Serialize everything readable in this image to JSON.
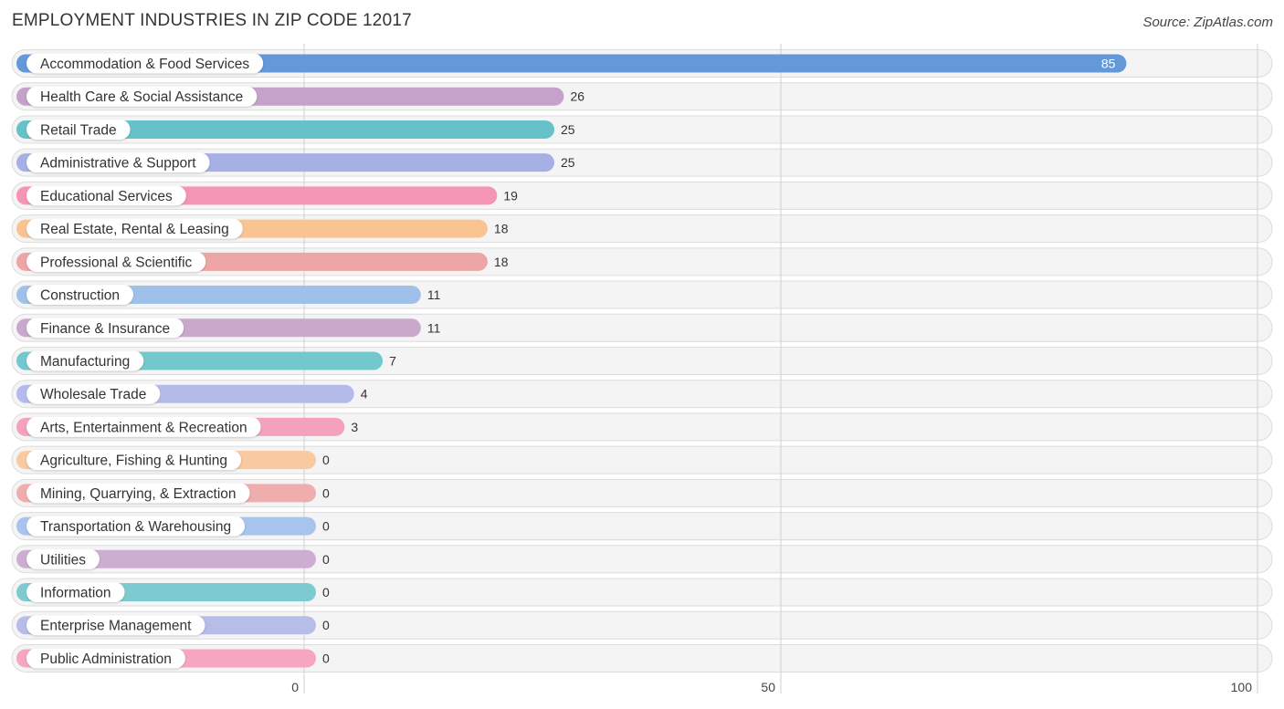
{
  "chart_data": {
    "type": "bar",
    "orientation": "horizontal",
    "title": "EMPLOYMENT INDUSTRIES IN ZIP CODE 12017",
    "source": "Source: ZipAtlas.com",
    "xlabel": "",
    "ylabel": "",
    "xlim": [
      0,
      100
    ],
    "x_ticks": [
      0,
      50,
      100
    ],
    "grid": true,
    "categories": [
      "Accommodation & Food Services",
      "Health Care & Social Assistance",
      "Retail Trade",
      "Administrative & Support",
      "Educational Services",
      "Real Estate, Rental & Leasing",
      "Professional & Scientific",
      "Construction",
      "Finance & Insurance",
      "Manufacturing",
      "Wholesale Trade",
      "Arts, Entertainment & Recreation",
      "Agriculture, Fishing & Hunting",
      "Mining, Quarrying, & Extraction",
      "Transportation & Warehousing",
      "Utilities",
      "Information",
      "Enterprise Management",
      "Public Administration"
    ],
    "values": [
      85,
      26,
      25,
      25,
      19,
      18,
      18,
      11,
      11,
      7,
      4,
      3,
      0,
      0,
      0,
      0,
      0,
      0,
      0
    ],
    "colors": [
      "#6499d8",
      "#c4a2c9",
      "#67c1c9",
      "#a6b0e4",
      "#f595b5",
      "#f9c492",
      "#eda5a5",
      "#9fc1e9",
      "#c9a8cc",
      "#73c8cd",
      "#b4bbea",
      "#f5a1be",
      "#f9c9a0",
      "#f0adad",
      "#a7c5ec",
      "#cdaed2",
      "#7dcbd1",
      "#b6bde9",
      "#f6a6c0"
    ]
  }
}
